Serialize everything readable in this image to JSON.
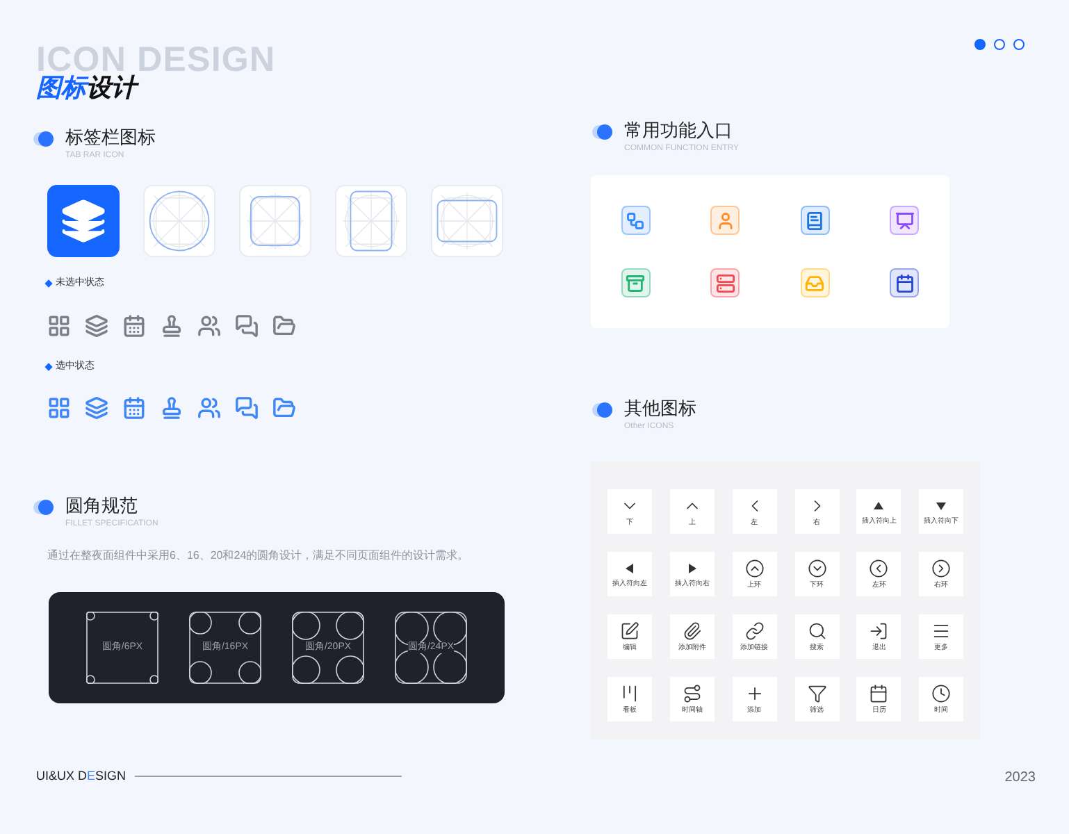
{
  "header": {
    "ghost_title": "ICON DESIGN",
    "title_accent": "图标",
    "title_rest": "设计"
  },
  "pagination": [
    {
      "selected": true
    },
    {
      "selected": false
    },
    {
      "selected": false
    }
  ],
  "tab_bar": {
    "title": "标签栏图标",
    "subtitle": "TAB RAR ICON",
    "cards": [
      {
        "kind": "app-icon"
      },
      {
        "kind": "circle"
      },
      {
        "kind": "square"
      },
      {
        "kind": "portrait"
      },
      {
        "kind": "landscape"
      }
    ],
    "states": [
      {
        "label": "未选中状态",
        "selected": false
      },
      {
        "label": "选中状态",
        "selected": true
      }
    ],
    "icons": [
      {
        "kind": "grid"
      },
      {
        "kind": "layers"
      },
      {
        "kind": "calendar"
      },
      {
        "kind": "stamp"
      },
      {
        "kind": "users"
      },
      {
        "kind": "chat"
      },
      {
        "kind": "folder"
      }
    ]
  },
  "fillet": {
    "title": "圆角规范",
    "subtitle": "FILLET SPECIFICATION",
    "description": "通过在整夜面组件中采用6、16、20和24的圆角设计，满足不同页面组件的设计需求。",
    "samples": [
      {
        "label": "圆角/6PX",
        "kind": "r6"
      },
      {
        "label": "圆角/16PX",
        "kind": "r16"
      },
      {
        "label": "圆角/20PX",
        "kind": "r20"
      },
      {
        "label": "圆角/24PX",
        "kind": "r24"
      }
    ]
  },
  "common": {
    "title": "常用功能入口",
    "subtitle": "COMMON FUNCTION ENTRY",
    "entries": [
      {
        "kind": "workflow",
        "color": "#2f88ff"
      },
      {
        "kind": "user",
        "color": "#ff8a1f"
      },
      {
        "kind": "book",
        "color": "#1a73e8"
      },
      {
        "kind": "presentation",
        "color": "#8c4bff"
      },
      {
        "kind": "archive",
        "color": "#1fb573"
      },
      {
        "kind": "server",
        "color": "#f5474f"
      },
      {
        "kind": "inbox",
        "color": "#ffb300"
      },
      {
        "kind": "calendar",
        "color": "#2845d6"
      }
    ]
  },
  "other": {
    "title": "其他图标",
    "subtitle": "Other ICONS",
    "items": [
      {
        "kind": "chevron-down",
        "label": "下"
      },
      {
        "kind": "chevron-up",
        "label": "上"
      },
      {
        "kind": "chevron-left",
        "label": "左"
      },
      {
        "kind": "chevron-right",
        "label": "右"
      },
      {
        "kind": "triangle-up",
        "label": "插入符向上"
      },
      {
        "kind": "triangle-down",
        "label": "插入符向下"
      },
      {
        "kind": "triangle-left",
        "label": "插入符向左"
      },
      {
        "kind": "triangle-right",
        "label": "插入符向右"
      },
      {
        "kind": "circle-up",
        "label": "上环"
      },
      {
        "kind": "circle-down",
        "label": "下环"
      },
      {
        "kind": "circle-left",
        "label": "左环"
      },
      {
        "kind": "circle-right",
        "label": "右环"
      },
      {
        "kind": "edit",
        "label": "编辑"
      },
      {
        "kind": "paperclip",
        "label": "添加附件"
      },
      {
        "kind": "link",
        "label": "添加链接"
      },
      {
        "kind": "search",
        "label": "搜索"
      },
      {
        "kind": "exit",
        "label": "退出"
      },
      {
        "kind": "menu",
        "label": "更多"
      },
      {
        "kind": "board",
        "label": "看板"
      },
      {
        "kind": "timeline",
        "label": "时间轴"
      },
      {
        "kind": "plus",
        "label": "添加"
      },
      {
        "kind": "filter",
        "label": "筛选"
      },
      {
        "kind": "calendar",
        "label": "日历"
      },
      {
        "kind": "clock",
        "label": "时间"
      }
    ]
  },
  "footer": {
    "brand_start": "UI&UX D",
    "brand_accent": "E",
    "brand_end": "SIGN",
    "year": "2023"
  }
}
